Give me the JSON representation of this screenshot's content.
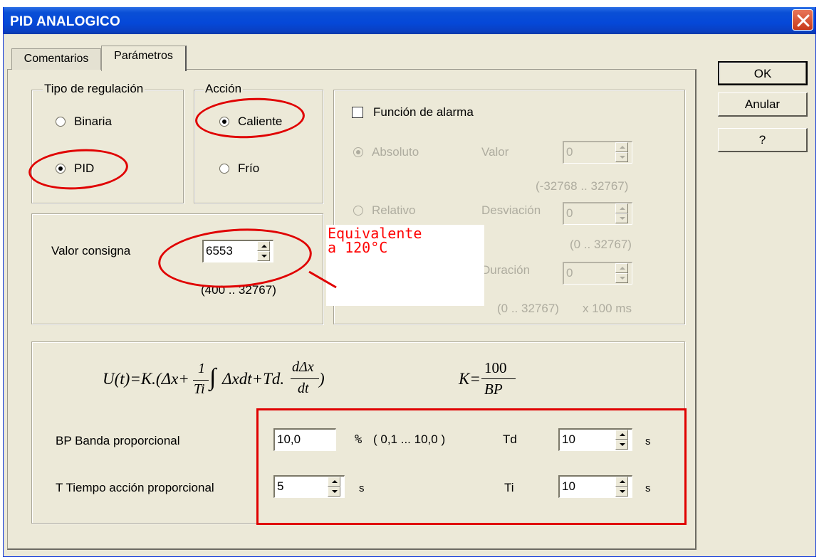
{
  "window": {
    "title": "PID ANALOGICO"
  },
  "tabs": [
    {
      "label": "Comentarios"
    },
    {
      "label": "Parámetros"
    }
  ],
  "buttons": {
    "ok": "OK",
    "cancel": "Anular",
    "help": "?"
  },
  "tipo_regulacion": {
    "legend": "Tipo de regulación",
    "binaria": "Binaria",
    "pid": "PID",
    "selected": "PID"
  },
  "accion": {
    "legend": "Acción",
    "caliente": "Caliente",
    "frio": "Frío",
    "selected": "Caliente"
  },
  "setpoint": {
    "label": "Valor consigna",
    "value": "6553",
    "range": "(400 .. 32767)"
  },
  "alarm": {
    "checkbox_label": "Función de alarma",
    "checked": false,
    "absoluto": "Absoluto",
    "relativo": "Relativo",
    "valor_label": "Valor",
    "valor_value": "0",
    "valor_range": "(-32768 .. 32767)",
    "desviacion_label": "Desviación",
    "desviacion_value": "0",
    "desviacion_range": "(0 .. 32767)",
    "duracion_label": "Duración",
    "duracion_value": "0",
    "duracion_range": "(0 .. 32767)",
    "duracion_unit": "x 100 ms"
  },
  "formula": {
    "u": "U(t)=K.(Δx+",
    "frac_num": "1",
    "frac_den": "Ti",
    "integral": "∫",
    "middle": "Δxdt+Td.",
    "deriv_num": "dΔx",
    "deriv_den": "dt",
    "close": ")",
    "k_lhs": "K=",
    "k_num": "100",
    "k_den": "BP"
  },
  "params": {
    "bp_label": "BP Banda proporcional",
    "bp_value": "10,0",
    "bp_unit": "%",
    "bp_range": "( 0,1 ... 10,0 )",
    "t_label": "T Tiempo acción proporcional",
    "t_value": "5",
    "t_unit": "s",
    "td_label": "Td",
    "td_value": "10",
    "td_unit": "s",
    "ti_label": "Ti",
    "ti_value": "10",
    "ti_unit": "s"
  },
  "annotation": {
    "text": "Equivalente\na 120°C"
  },
  "colors": {
    "annotation_red": "#e00000",
    "titlebar_blue": "#0a4fd6",
    "dialog_bg": "#ece9d8"
  }
}
